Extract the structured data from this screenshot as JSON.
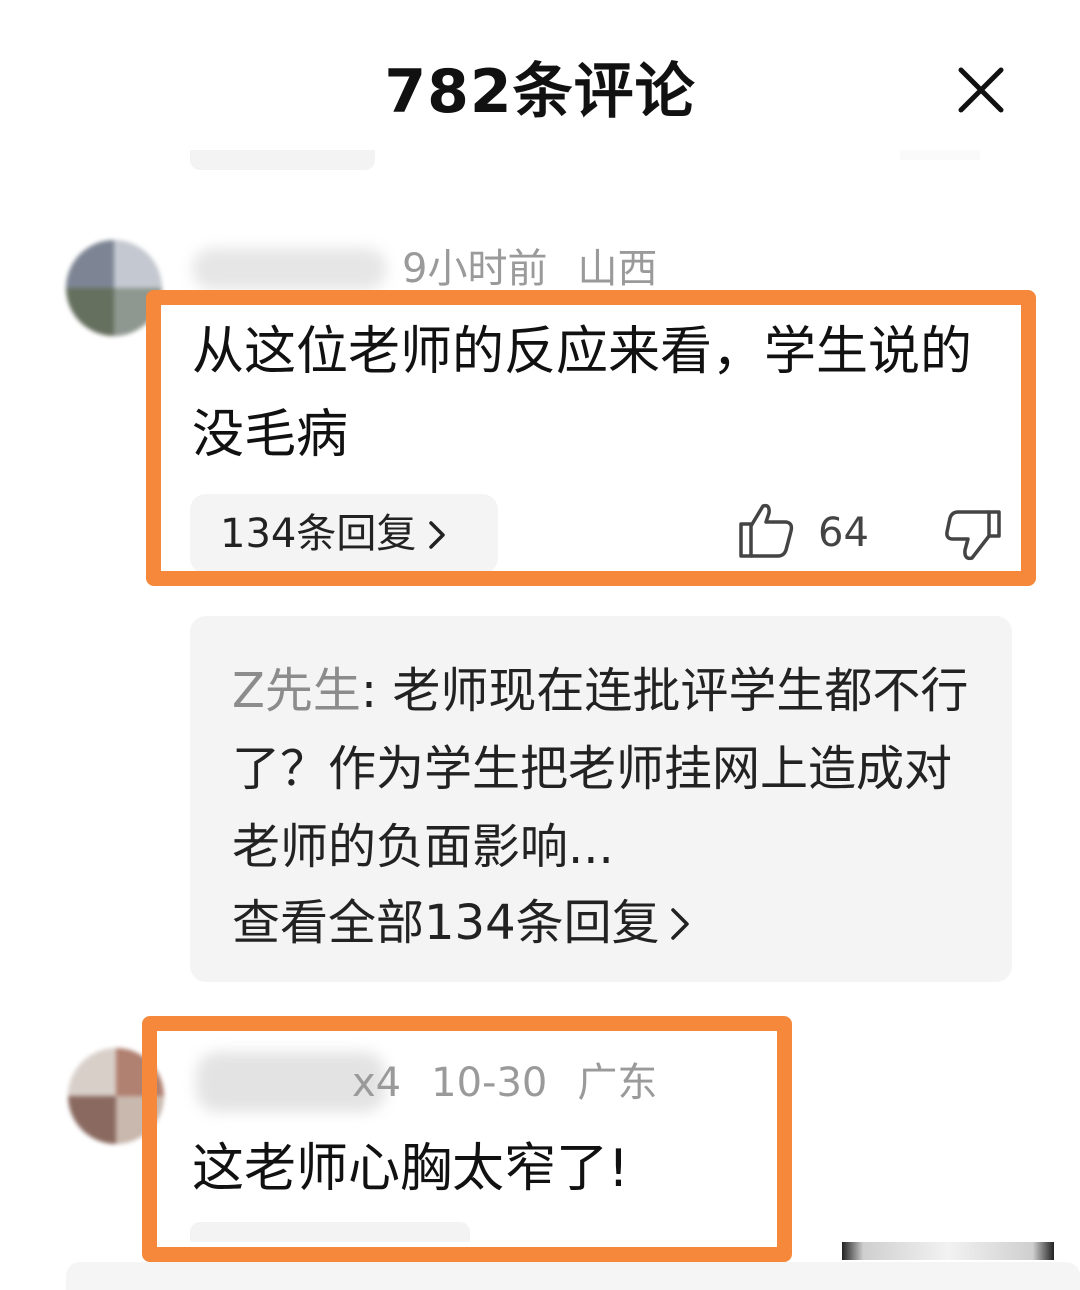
{
  "header": {
    "title": "782条评论",
    "close_icon": "close-icon"
  },
  "comments": [
    {
      "time": "9小时前",
      "location": "山西",
      "text": "从这位老师的反应来看，学生说的没毛病",
      "replies_button": "134条回复",
      "likes": "64",
      "highlighted": true,
      "reply_preview": {
        "author": "Z先生",
        "text": "老师现在连批评学生都不行了？作为学生把老师挂网上造成对老师的负面影响...",
        "view_all": "查看全部134条回复"
      }
    },
    {
      "name_fragment": "x4",
      "time": "10-30",
      "location": "广东",
      "text": "这老师心胸太窄了!",
      "highlighted": true
    }
  ],
  "colors": {
    "highlight": "#f5883a",
    "meta_gray": "#9a9a9a",
    "panel_bg": "#f4f4f4"
  }
}
